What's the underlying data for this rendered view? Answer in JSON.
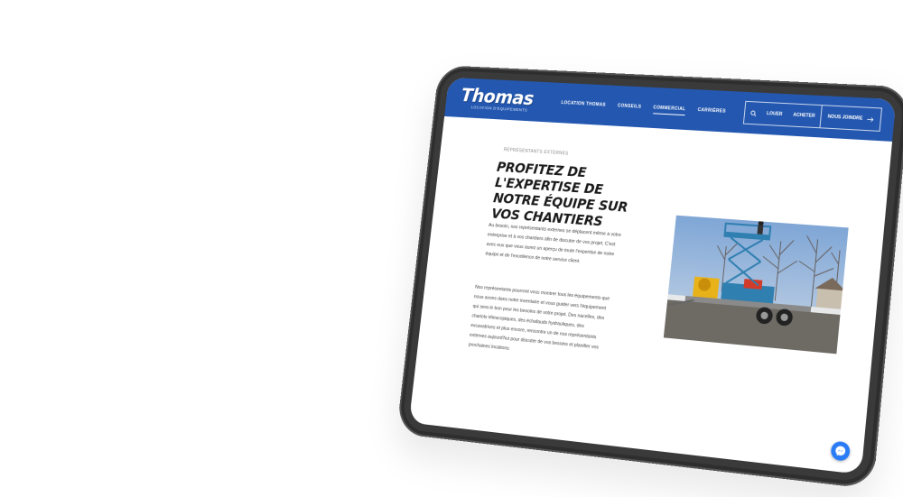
{
  "header": {
    "logo_text": "Thomas",
    "logo_tagline": "LOCATION D'ÉQUIPEMENTS",
    "nav": [
      {
        "label": "LOCATION THOMAS"
      },
      {
        "label": "CONSEILS"
      },
      {
        "label": "COMMERCIAL",
        "active": true
      },
      {
        "label": "CARRIÈRES"
      }
    ],
    "actions": {
      "search_icon": "search-icon",
      "rent_label": "LOUER",
      "buy_label": "ACHETER",
      "join_label": "NOUS JOINDRE",
      "join_icon": "arrow-right-icon"
    }
  },
  "content": {
    "eyebrow": "REPRÉSENTANTS EXTERNES",
    "headline": "PROFITEZ DE L'EXPERTISE DE NOTRE ÉQUIPE SUR VOS CHANTIERS",
    "paragraph_1": "Au besoin, nos représentants externes se déplacent même à votre entreprise et à vos chantiers afin de discuter de vos projet. C'est avec eux que vous aurez un aperçu de toute l'expertise de notre équipe et de l'excellence de notre service client.",
    "paragraph_2": "Nos représentants pourront vous montrer tous les équipements que nous avons dans notre inventaire et vous guider vers l'équipement qui sera le bon pour les besoins de votre projet. Des nacelles, des chariots télescopiques, des échafauds hydrauliques, des excavatrices et plus encore, rencontre un de nos représentants externes aujourd'hui pour discuter de vos besoins et planifier vos prochaines locations."
  },
  "photo": {
    "subject": "scissor-lift-on-trailer"
  },
  "chat": {
    "icon": "messenger-icon"
  },
  "colors": {
    "brand_blue": "#2458b0",
    "device_frame": "#3a3a3a",
    "messenger_blue": "#2a7cf6"
  }
}
